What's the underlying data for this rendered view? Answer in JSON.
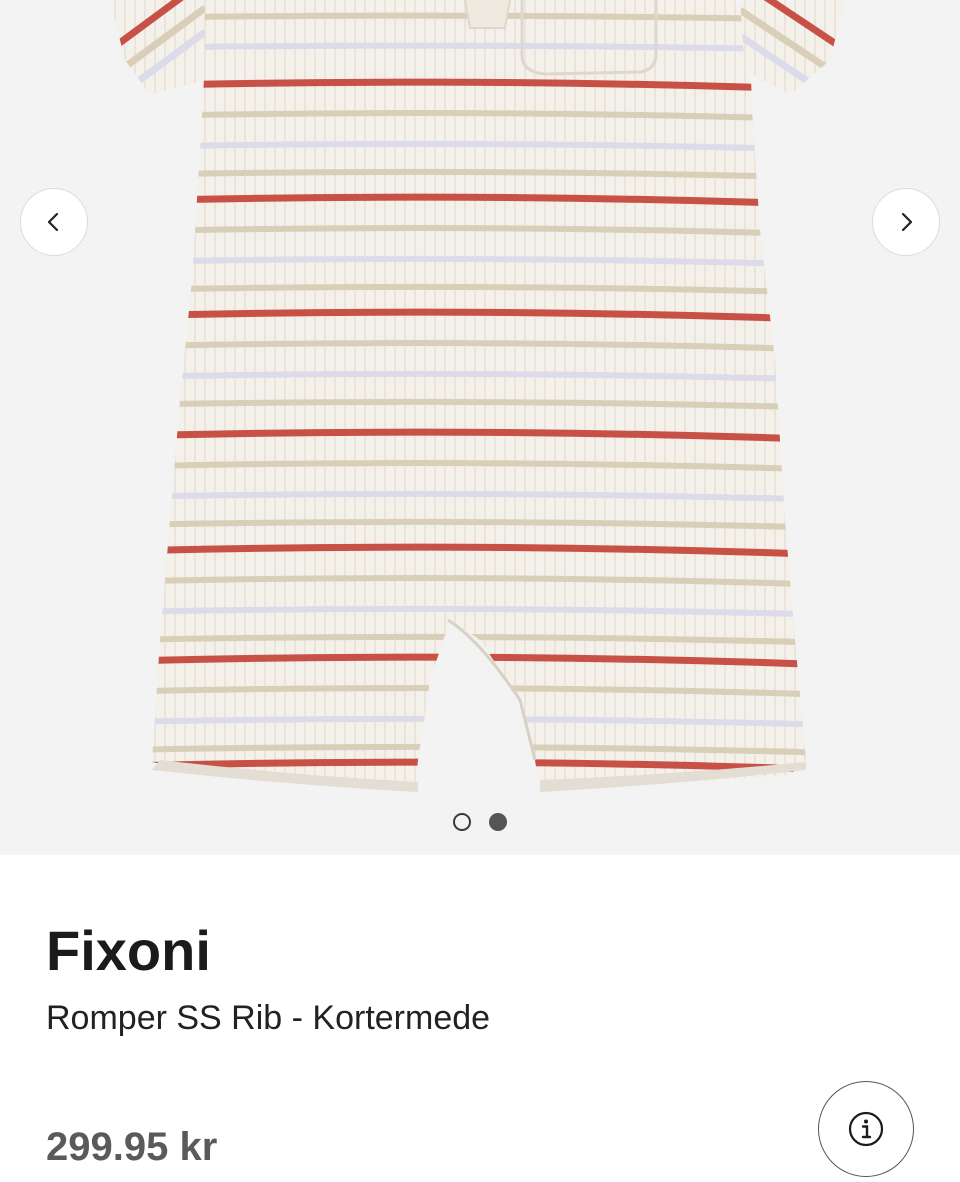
{
  "product": {
    "brand": "Fixoni",
    "name": "Romper SS Rib - Kortermede",
    "price": "299.95 kr"
  },
  "gallery": {
    "prev_icon": "chevron-left-icon",
    "next_icon": "chevron-right-icon",
    "dots": [
      {
        "active": false
      },
      {
        "active": true
      }
    ],
    "stripe_colors": {
      "base": "#f3eee7",
      "red": "#c75146",
      "beige": "#d9cfb8",
      "lavender": "#dcdbea"
    }
  },
  "info_icon": "info-icon"
}
